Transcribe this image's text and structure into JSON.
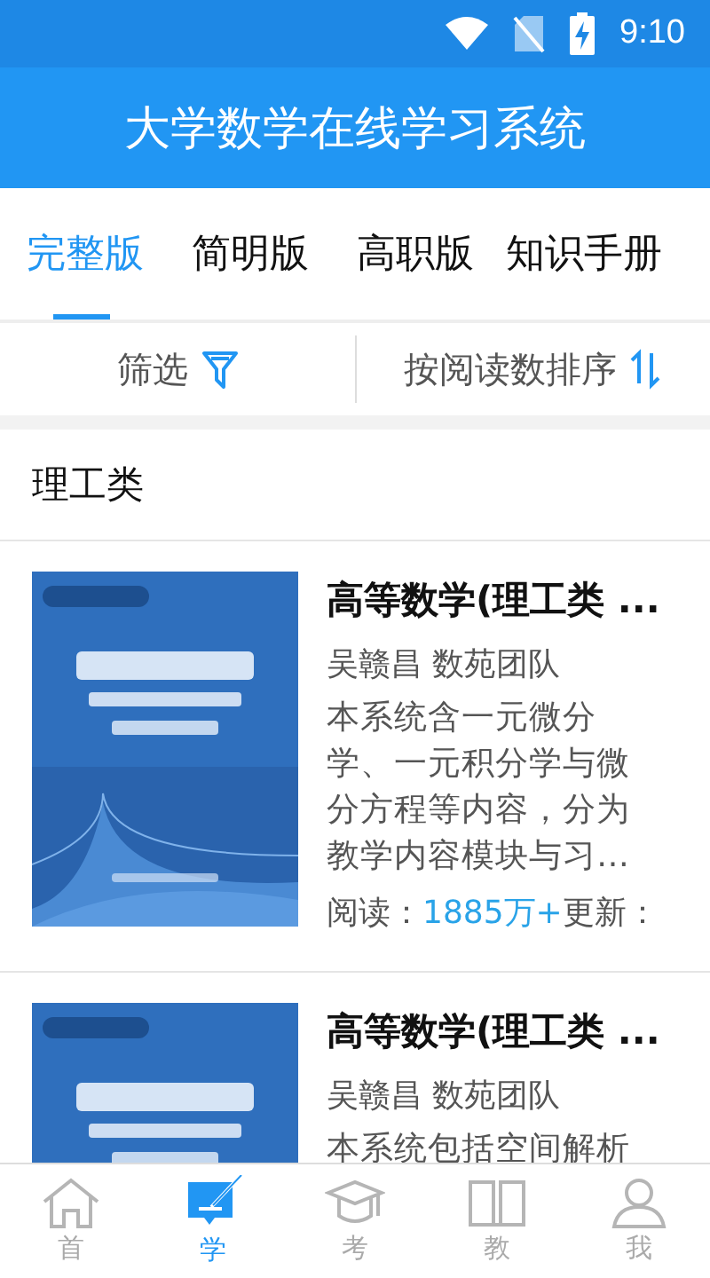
{
  "status_bar": {
    "time": "9:10"
  },
  "app_bar": {
    "title": "大学数学在线学习系统"
  },
  "tabs": [
    {
      "label": "完整版",
      "selected": true
    },
    {
      "label": "简明版",
      "selected": false
    },
    {
      "label": "高职版",
      "selected": false
    },
    {
      "label": "知识手册",
      "selected": false
    }
  ],
  "toolbar": {
    "filter": "筛选",
    "sort": "按阅读数排序"
  },
  "section": {
    "title": "理工类"
  },
  "books": [
    {
      "title": "高等数学(理工类 ...",
      "authors": "吴赣昌 数苑团队",
      "description": "本系统含一元微分学、一元积分学与微分方程等内容，分为教学内容模块与习…",
      "reads_label": "阅读：",
      "reads": "1885万+",
      "updated_label": "更新："
    },
    {
      "title": "高等数学(理工类 ...",
      "authors": "吴赣昌 数苑团队",
      "description": "本系统包括空间解析"
    }
  ],
  "bottom_nav": [
    {
      "label": "首",
      "kind": "home",
      "selected": false
    },
    {
      "label": "学",
      "kind": "study",
      "selected": true
    },
    {
      "label": "考",
      "kind": "exam",
      "selected": false
    },
    {
      "label": "教",
      "kind": "book",
      "selected": false
    },
    {
      "label": "我",
      "kind": "user",
      "selected": false
    }
  ]
}
